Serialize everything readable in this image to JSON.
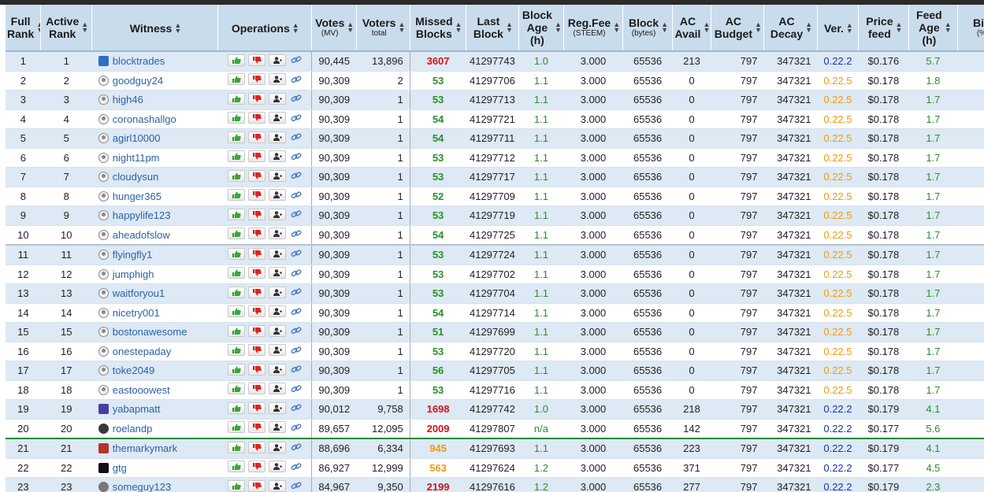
{
  "columns": [
    {
      "label": "Full\nRank",
      "sub": ""
    },
    {
      "label": "Active\nRank",
      "sub": ""
    },
    {
      "label": "Witness",
      "sub": ""
    },
    {
      "label": "Operations",
      "sub": ""
    },
    {
      "label": "Votes",
      "sub": "(MV)"
    },
    {
      "label": "Voters",
      "sub": "total"
    },
    {
      "label": "Missed\nBlocks",
      "sub": ""
    },
    {
      "label": "Last\nBlock",
      "sub": ""
    },
    {
      "label": "Block\nAge\n(h)",
      "sub": ""
    },
    {
      "label": "Reg.Fee",
      "sub": "(STEEM)"
    },
    {
      "label": "Block",
      "sub": "(bytes)"
    },
    {
      "label": "AC\nAvail",
      "sub": ""
    },
    {
      "label": "AC\nBudget",
      "sub": ""
    },
    {
      "label": "AC\nDecay",
      "sub": ""
    },
    {
      "label": "Ver.",
      "sub": ""
    },
    {
      "label": "Price\nfeed",
      "sub": ""
    },
    {
      "label": "Feed\nAge\n(h)",
      "sub": ""
    },
    {
      "label": "Bia",
      "sub": "(%"
    }
  ],
  "sort_glyph": "▲▼",
  "icons": {
    "upvote": "thumbs-up-icon",
    "downvote": "thumbs-down-icon",
    "proxy": "add-user-icon",
    "link": "link-icon"
  },
  "colors": {
    "header_bg": "#c9dcec",
    "row_alt": "#dde9f4",
    "link_blue": "#2b62a8",
    "missed_red": "#d21414",
    "ok_green": "#2a8f2a",
    "old_version_orange": "#ef9b0f",
    "current_version_blue": "#1436b0"
  },
  "rows": [
    {
      "full": "1",
      "active": "1",
      "witness": "blocktrades",
      "avatar": "custom-blue",
      "votes": "90,445",
      "voters": "13,896",
      "missed": "3607",
      "missed_c": "red",
      "last": "41297743",
      "age": "1.0",
      "reg": "3.000",
      "block": "65536",
      "ac_avail": "213",
      "ac_budget": "797",
      "ac_decay": "347321",
      "ver": "0.22.2",
      "ver_c": "blue",
      "price": "$0.176",
      "feed_age": "5.7",
      "sep": ""
    },
    {
      "full": "2",
      "active": "2",
      "witness": "goodguy24",
      "avatar": "default",
      "votes": "90,309",
      "voters": "2",
      "missed": "53",
      "missed_c": "green",
      "last": "41297706",
      "age": "1.1",
      "reg": "3.000",
      "block": "65536",
      "ac_avail": "0",
      "ac_budget": "797",
      "ac_decay": "347321",
      "ver": "0.22.5",
      "ver_c": "orange",
      "price": "$0.178",
      "feed_age": "1.8",
      "sep": ""
    },
    {
      "full": "3",
      "active": "3",
      "witness": "high46",
      "avatar": "default",
      "votes": "90,309",
      "voters": "1",
      "missed": "53",
      "missed_c": "green",
      "last": "41297713",
      "age": "1.1",
      "reg": "3.000",
      "block": "65536",
      "ac_avail": "0",
      "ac_budget": "797",
      "ac_decay": "347321",
      "ver": "0.22.5",
      "ver_c": "orange",
      "price": "$0.178",
      "feed_age": "1.7",
      "sep": ""
    },
    {
      "full": "4",
      "active": "4",
      "witness": "coronashallgo",
      "avatar": "default",
      "votes": "90,309",
      "voters": "1",
      "missed": "54",
      "missed_c": "green",
      "last": "41297721",
      "age": "1.1",
      "reg": "3.000",
      "block": "65536",
      "ac_avail": "0",
      "ac_budget": "797",
      "ac_decay": "347321",
      "ver": "0.22.5",
      "ver_c": "orange",
      "price": "$0.178",
      "feed_age": "1.7",
      "sep": ""
    },
    {
      "full": "5",
      "active": "5",
      "witness": "agirl10000",
      "avatar": "default",
      "votes": "90,309",
      "voters": "1",
      "missed": "54",
      "missed_c": "green",
      "last": "41297711",
      "age": "1.1",
      "reg": "3.000",
      "block": "65536",
      "ac_avail": "0",
      "ac_budget": "797",
      "ac_decay": "347321",
      "ver": "0.22.5",
      "ver_c": "orange",
      "price": "$0.178",
      "feed_age": "1.7",
      "sep": ""
    },
    {
      "full": "6",
      "active": "6",
      "witness": "night11pm",
      "avatar": "default",
      "votes": "90,309",
      "voters": "1",
      "missed": "53",
      "missed_c": "green",
      "last": "41297712",
      "age": "1.1",
      "reg": "3.000",
      "block": "65536",
      "ac_avail": "0",
      "ac_budget": "797",
      "ac_decay": "347321",
      "ver": "0.22.5",
      "ver_c": "orange",
      "price": "$0.178",
      "feed_age": "1.7",
      "sep": ""
    },
    {
      "full": "7",
      "active": "7",
      "witness": "cloudysun",
      "avatar": "default",
      "votes": "90,309",
      "voters": "1",
      "missed": "53",
      "missed_c": "green",
      "last": "41297717",
      "age": "1.1",
      "reg": "3.000",
      "block": "65536",
      "ac_avail": "0",
      "ac_budget": "797",
      "ac_decay": "347321",
      "ver": "0.22.5",
      "ver_c": "orange",
      "price": "$0.178",
      "feed_age": "1.7",
      "sep": ""
    },
    {
      "full": "8",
      "active": "8",
      "witness": "hunger365",
      "avatar": "default",
      "votes": "90,309",
      "voters": "1",
      "missed": "52",
      "missed_c": "green",
      "last": "41297709",
      "age": "1.1",
      "reg": "3.000",
      "block": "65536",
      "ac_avail": "0",
      "ac_budget": "797",
      "ac_decay": "347321",
      "ver": "0.22.5",
      "ver_c": "orange",
      "price": "$0.178",
      "feed_age": "1.7",
      "sep": ""
    },
    {
      "full": "9",
      "active": "9",
      "witness": "happylife123",
      "avatar": "default",
      "votes": "90,309",
      "voters": "1",
      "missed": "53",
      "missed_c": "green",
      "last": "41297719",
      "age": "1.1",
      "reg": "3.000",
      "block": "65536",
      "ac_avail": "0",
      "ac_budget": "797",
      "ac_decay": "347321",
      "ver": "0.22.5",
      "ver_c": "orange",
      "price": "$0.178",
      "feed_age": "1.7",
      "sep": ""
    },
    {
      "full": "10",
      "active": "10",
      "witness": "aheadofslow",
      "avatar": "default",
      "votes": "90,309",
      "voters": "1",
      "missed": "54",
      "missed_c": "green",
      "last": "41297725",
      "age": "1.1",
      "reg": "3.000",
      "block": "65536",
      "ac_avail": "0",
      "ac_budget": "797",
      "ac_decay": "347321",
      "ver": "0.22.5",
      "ver_c": "orange",
      "price": "$0.178",
      "feed_age": "1.7",
      "sep": ""
    },
    {
      "full": "11",
      "active": "11",
      "witness": "flyingfly1",
      "avatar": "default",
      "votes": "90,309",
      "voters": "1",
      "missed": "53",
      "missed_c": "green",
      "last": "41297724",
      "age": "1.1",
      "reg": "3.000",
      "block": "65536",
      "ac_avail": "0",
      "ac_budget": "797",
      "ac_decay": "347321",
      "ver": "0.22.5",
      "ver_c": "orange",
      "price": "$0.178",
      "feed_age": "1.7",
      "sep": "gray"
    },
    {
      "full": "12",
      "active": "12",
      "witness": "jumphigh",
      "avatar": "default",
      "votes": "90,309",
      "voters": "1",
      "missed": "53",
      "missed_c": "green",
      "last": "41297702",
      "age": "1.1",
      "reg": "3.000",
      "block": "65536",
      "ac_avail": "0",
      "ac_budget": "797",
      "ac_decay": "347321",
      "ver": "0.22.5",
      "ver_c": "orange",
      "price": "$0.178",
      "feed_age": "1.7",
      "sep": ""
    },
    {
      "full": "13",
      "active": "13",
      "witness": "waitforyou1",
      "avatar": "default",
      "votes": "90,309",
      "voters": "1",
      "missed": "53",
      "missed_c": "green",
      "last": "41297704",
      "age": "1.1",
      "reg": "3.000",
      "block": "65536",
      "ac_avail": "0",
      "ac_budget": "797",
      "ac_decay": "347321",
      "ver": "0.22.5",
      "ver_c": "orange",
      "price": "$0.178",
      "feed_age": "1.7",
      "sep": ""
    },
    {
      "full": "14",
      "active": "14",
      "witness": "nicetry001",
      "avatar": "default",
      "votes": "90,309",
      "voters": "1",
      "missed": "54",
      "missed_c": "green",
      "last": "41297714",
      "age": "1.1",
      "reg": "3.000",
      "block": "65536",
      "ac_avail": "0",
      "ac_budget": "797",
      "ac_decay": "347321",
      "ver": "0.22.5",
      "ver_c": "orange",
      "price": "$0.178",
      "feed_age": "1.7",
      "sep": ""
    },
    {
      "full": "15",
      "active": "15",
      "witness": "bostonawesome",
      "avatar": "default",
      "votes": "90,309",
      "voters": "1",
      "missed": "51",
      "missed_c": "green",
      "last": "41297699",
      "age": "1.1",
      "reg": "3.000",
      "block": "65536",
      "ac_avail": "0",
      "ac_budget": "797",
      "ac_decay": "347321",
      "ver": "0.22.5",
      "ver_c": "orange",
      "price": "$0.178",
      "feed_age": "1.7",
      "sep": ""
    },
    {
      "full": "16",
      "active": "16",
      "witness": "onestepaday",
      "avatar": "default",
      "votes": "90,309",
      "voters": "1",
      "missed": "53",
      "missed_c": "green",
      "last": "41297720",
      "age": "1.1",
      "reg": "3.000",
      "block": "65536",
      "ac_avail": "0",
      "ac_budget": "797",
      "ac_decay": "347321",
      "ver": "0.22.5",
      "ver_c": "orange",
      "price": "$0.178",
      "feed_age": "1.7",
      "sep": ""
    },
    {
      "full": "17",
      "active": "17",
      "witness": "toke2049",
      "avatar": "default",
      "votes": "90,309",
      "voters": "1",
      "missed": "56",
      "missed_c": "green",
      "last": "41297705",
      "age": "1.1",
      "reg": "3.000",
      "block": "65536",
      "ac_avail": "0",
      "ac_budget": "797",
      "ac_decay": "347321",
      "ver": "0.22.5",
      "ver_c": "orange",
      "price": "$0.178",
      "feed_age": "1.7",
      "sep": ""
    },
    {
      "full": "18",
      "active": "18",
      "witness": "eastooowest",
      "avatar": "default",
      "votes": "90,309",
      "voters": "1",
      "missed": "53",
      "missed_c": "green",
      "last": "41297716",
      "age": "1.1",
      "reg": "3.000",
      "block": "65536",
      "ac_avail": "0",
      "ac_budget": "797",
      "ac_decay": "347321",
      "ver": "0.22.5",
      "ver_c": "orange",
      "price": "$0.178",
      "feed_age": "1.7",
      "sep": ""
    },
    {
      "full": "19",
      "active": "19",
      "witness": "yabapmatt",
      "avatar": "custom-purple",
      "votes": "90,012",
      "voters": "9,758",
      "missed": "1698",
      "missed_c": "red",
      "last": "41297742",
      "age": "1.0",
      "reg": "3.000",
      "block": "65536",
      "ac_avail": "218",
      "ac_budget": "797",
      "ac_decay": "347321",
      "ver": "0.22.2",
      "ver_c": "blue",
      "price": "$0.179",
      "feed_age": "4.1",
      "sep": ""
    },
    {
      "full": "20",
      "active": "20",
      "witness": "roelandp",
      "avatar": "custom-dark",
      "votes": "89,657",
      "voters": "12,095",
      "missed": "2009",
      "missed_c": "red",
      "last": "41297807",
      "age": "n/a",
      "reg": "3.000",
      "block": "65536",
      "ac_avail": "142",
      "ac_budget": "797",
      "ac_decay": "347321",
      "ver": "0.22.2",
      "ver_c": "blue",
      "price": "$0.177",
      "feed_age": "5.6",
      "sep": ""
    },
    {
      "full": "21",
      "active": "21",
      "witness": "themarkymark",
      "avatar": "custom-red",
      "votes": "88,696",
      "voters": "6,334",
      "missed": "945",
      "missed_c": "orange",
      "last": "41297693",
      "age": "1.1",
      "reg": "3.000",
      "block": "65536",
      "ac_avail": "223",
      "ac_budget": "797",
      "ac_decay": "347321",
      "ver": "0.22.2",
      "ver_c": "blue",
      "price": "$0.179",
      "feed_age": "4.1",
      "sep": "green"
    },
    {
      "full": "22",
      "active": "22",
      "witness": "gtg",
      "avatar": "custom-black",
      "votes": "86,927",
      "voters": "12,999",
      "missed": "563",
      "missed_c": "orange",
      "last": "41297624",
      "age": "1.2",
      "reg": "3.000",
      "block": "65536",
      "ac_avail": "371",
      "ac_budget": "797",
      "ac_decay": "347321",
      "ver": "0.22.2",
      "ver_c": "blue",
      "price": "$0.177",
      "feed_age": "4.5",
      "sep": ""
    },
    {
      "full": "23",
      "active": "23",
      "witness": "someguy123",
      "avatar": "custom-gray",
      "votes": "84,967",
      "voters": "9,350",
      "missed": "2199",
      "missed_c": "red",
      "last": "41297616",
      "age": "1.2",
      "reg": "3.000",
      "block": "65536",
      "ac_avail": "277",
      "ac_budget": "797",
      "ac_decay": "347321",
      "ver": "0.22.2",
      "ver_c": "blue",
      "price": "$0.179",
      "feed_age": "2.3",
      "sep": ""
    }
  ]
}
